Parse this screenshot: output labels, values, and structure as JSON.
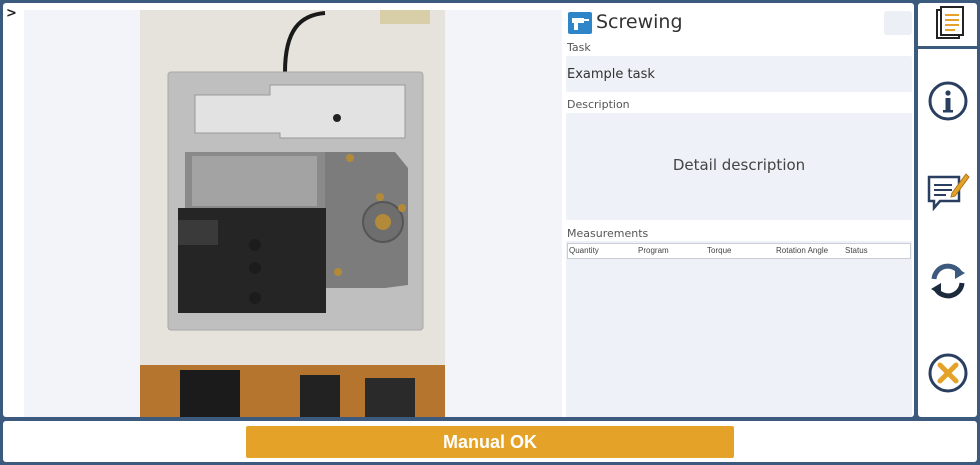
{
  "sidebar_toggle": {
    "glyph": ">"
  },
  "detail": {
    "title": "Screwing",
    "tool_icon": "drill-icon",
    "task_label": "Task",
    "task_value": "Example task",
    "description_label": "Description",
    "description_value": "Detail description",
    "measurements_label": "Measurements",
    "measurement_columns": [
      "Quantity",
      "Program",
      "Torque",
      "Rotation Angle",
      "Status"
    ]
  },
  "sidebar": {
    "items": [
      {
        "icon": "document-icon"
      },
      {
        "icon": "info-icon"
      },
      {
        "icon": "comment-edit-icon"
      },
      {
        "icon": "refresh-icon"
      },
      {
        "icon": "cancel-icon"
      }
    ]
  },
  "footer": {
    "manual_ok_label": "Manual OK"
  },
  "colors": {
    "frame": "#3c5a7d",
    "accent": "#e4a229",
    "panel": "#eef1f7",
    "tool_icon": "#2e86c9"
  }
}
